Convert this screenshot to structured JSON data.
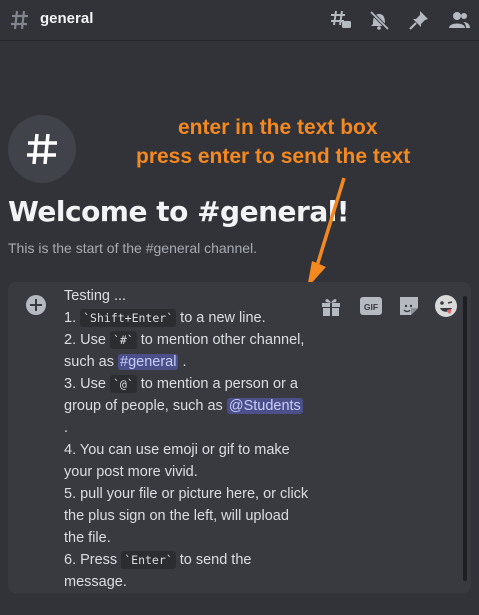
{
  "header": {
    "channel_name": "general",
    "icons": [
      "threads-icon",
      "mute-bell-icon",
      "pin-icon",
      "members-icon"
    ]
  },
  "welcome": {
    "title": "Welcome to #general!",
    "subtitle": "This is the start of the #general channel."
  },
  "annotation": {
    "line1": "enter in the text box",
    "line2": "press enter to send the text",
    "color": "#f4891f"
  },
  "composer": {
    "lines": {
      "l1": "Testing ...",
      "l2a": "1. ",
      "l2code": "`Shift+Enter`",
      "l2b": " to a new line.",
      "l3a": "2. Use ",
      "l3code": "`#`",
      "l3b": " to mention other channel, such as ",
      "l3mention": "#general",
      "l3c": " .",
      "l4a": "3. Use ",
      "l4code": "`@`",
      "l4b": " to mention a person or a group of people, such as ",
      "l4mention": "@Students",
      "l4c": " .",
      "l5": "4. You can use emoji or gif to make your post more vivid.",
      "l6": "5. pull your file or picture here, or click the plus sign on the left, will upload the file.",
      "l7a": "6. Press ",
      "l7code": "`Enter`",
      "l7b": " to send the message."
    },
    "gif_label": "GIF",
    "icons": [
      "gift-icon",
      "gif-icon",
      "sticker-icon",
      "emoji-icon"
    ]
  }
}
